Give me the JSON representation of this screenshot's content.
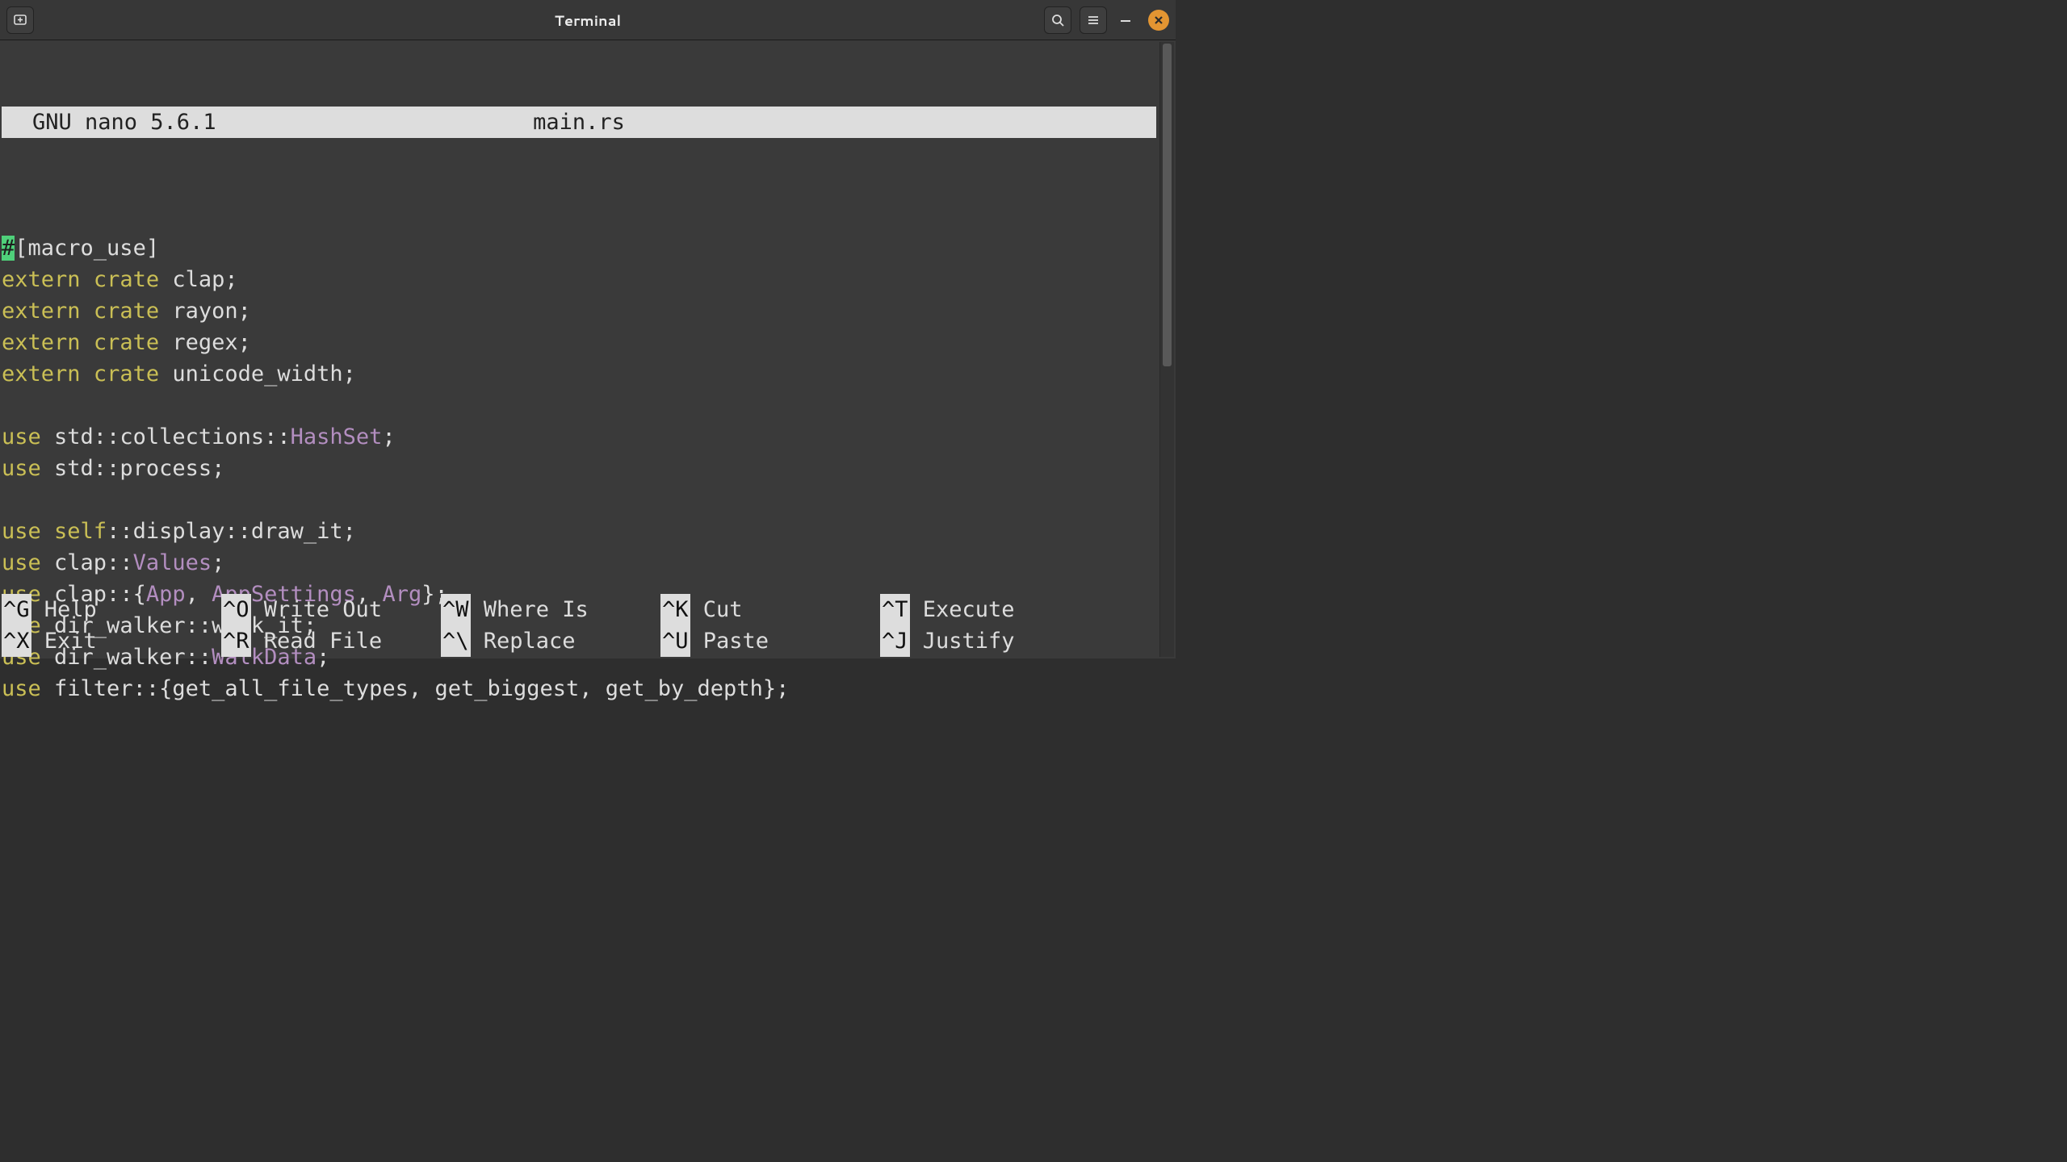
{
  "window": {
    "title": "Terminal"
  },
  "nano": {
    "app": "GNU nano 5.6.1",
    "filename": "main.rs"
  },
  "code": {
    "lines": [
      [
        {
          "t": "#",
          "cls": "cursor-cell"
        },
        {
          "t": "[macro_use]",
          "cls": "tok-plain"
        }
      ],
      [
        {
          "t": "extern",
          "cls": "tok-kw"
        },
        {
          "t": " ",
          "cls": "tok-plain"
        },
        {
          "t": "crate",
          "cls": "tok-kw"
        },
        {
          "t": " clap;",
          "cls": "tok-plain"
        }
      ],
      [
        {
          "t": "extern",
          "cls": "tok-kw"
        },
        {
          "t": " ",
          "cls": "tok-plain"
        },
        {
          "t": "crate",
          "cls": "tok-kw"
        },
        {
          "t": " rayon;",
          "cls": "tok-plain"
        }
      ],
      [
        {
          "t": "extern",
          "cls": "tok-kw"
        },
        {
          "t": " ",
          "cls": "tok-plain"
        },
        {
          "t": "crate",
          "cls": "tok-kw"
        },
        {
          "t": " regex;",
          "cls": "tok-plain"
        }
      ],
      [
        {
          "t": "extern",
          "cls": "tok-kw"
        },
        {
          "t": " ",
          "cls": "tok-plain"
        },
        {
          "t": "crate",
          "cls": "tok-kw"
        },
        {
          "t": " unicode_width;",
          "cls": "tok-plain"
        }
      ],
      [
        {
          "t": " ",
          "cls": "tok-plain"
        }
      ],
      [
        {
          "t": "use",
          "cls": "tok-kw"
        },
        {
          "t": " std::collections::",
          "cls": "tok-plain"
        },
        {
          "t": "HashSet",
          "cls": "tok-type"
        },
        {
          "t": ";",
          "cls": "tok-plain"
        }
      ],
      [
        {
          "t": "use",
          "cls": "tok-kw"
        },
        {
          "t": " std::process;",
          "cls": "tok-plain"
        }
      ],
      [
        {
          "t": " ",
          "cls": "tok-plain"
        }
      ],
      [
        {
          "t": "use",
          "cls": "tok-kw"
        },
        {
          "t": " ",
          "cls": "tok-plain"
        },
        {
          "t": "self",
          "cls": "tok-kw"
        },
        {
          "t": "::display::draw_it;",
          "cls": "tok-plain"
        }
      ],
      [
        {
          "t": "use",
          "cls": "tok-kw"
        },
        {
          "t": " clap::",
          "cls": "tok-plain"
        },
        {
          "t": "Values",
          "cls": "tok-type"
        },
        {
          "t": ";",
          "cls": "tok-plain"
        }
      ],
      [
        {
          "t": "use",
          "cls": "tok-kw"
        },
        {
          "t": " clap::{",
          "cls": "tok-plain"
        },
        {
          "t": "App",
          "cls": "tok-type"
        },
        {
          "t": ", ",
          "cls": "tok-plain"
        },
        {
          "t": "AppSettings",
          "cls": "tok-type"
        },
        {
          "t": ", ",
          "cls": "tok-plain"
        },
        {
          "t": "Arg",
          "cls": "tok-type"
        },
        {
          "t": "};",
          "cls": "tok-plain"
        }
      ],
      [
        {
          "t": "use",
          "cls": "tok-kw"
        },
        {
          "t": " dir_walker::walk_it;",
          "cls": "tok-plain"
        }
      ],
      [
        {
          "t": "use",
          "cls": "tok-kw"
        },
        {
          "t": " dir_walker::",
          "cls": "tok-plain"
        },
        {
          "t": "WalkData",
          "cls": "tok-type"
        },
        {
          "t": ";",
          "cls": "tok-plain"
        }
      ],
      [
        {
          "t": "use",
          "cls": "tok-kw"
        },
        {
          "t": " filter::{get_all_file_types, get_biggest, get_by_depth};",
          "cls": "tok-plain"
        }
      ]
    ]
  },
  "help": {
    "rows": [
      [
        {
          "key": "^G",
          "label": "Help"
        },
        {
          "key": "^O",
          "label": "Write Out"
        },
        {
          "key": "^W",
          "label": "Where Is"
        },
        {
          "key": "^K",
          "label": "Cut"
        },
        {
          "key": "^T",
          "label": "Execute"
        }
      ],
      [
        {
          "key": "^X",
          "label": "Exit"
        },
        {
          "key": "^R",
          "label": "Read File"
        },
        {
          "key": "^\\",
          "label": "Replace"
        },
        {
          "key": "^U",
          "label": "Paste"
        },
        {
          "key": "^J",
          "label": "Justify"
        }
      ]
    ]
  },
  "colors": {
    "bg": "#3a3a3a",
    "fg": "#ddd",
    "keyword": "#cabf55",
    "type": "#b38ec0",
    "cursor_bg": "#4fd07a",
    "titlebar_bg": "#373737",
    "close_btn": "#e39532"
  }
}
